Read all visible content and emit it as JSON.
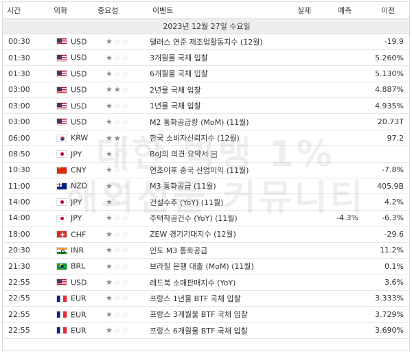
{
  "headers": {
    "time": "시간",
    "currency": "외화",
    "importance": "중요성",
    "event": "이벤트",
    "actual": "실제",
    "forecast": "예측",
    "previous": "이전"
  },
  "date_label": "2023년 12월 27일 수요일",
  "watermark": [
    "대한 빅뱅 1%",
    "해외선물 커뮤니티"
  ],
  "rows": [
    {
      "time": "00:30",
      "flag": "us",
      "currency": "USD",
      "stars": 1,
      "event": "댈러스 연준 제조업활동지수 (12월)",
      "actual": "",
      "forecast": "",
      "previous": "-19.9"
    },
    {
      "time": "01:30",
      "flag": "us",
      "currency": "USD",
      "stars": 1,
      "event": "3개월물 국채 입찰",
      "actual": "",
      "forecast": "",
      "previous": "5.260%"
    },
    {
      "time": "01:30",
      "flag": "us",
      "currency": "USD",
      "stars": 1,
      "event": "6개월물 국채 입찰",
      "actual": "",
      "forecast": "",
      "previous": "5.130%"
    },
    {
      "time": "03:00",
      "flag": "us",
      "currency": "USD",
      "stars": 2,
      "event": "2년물 국채 입찰",
      "actual": "",
      "forecast": "",
      "previous": "4.887%"
    },
    {
      "time": "03:00",
      "flag": "us",
      "currency": "USD",
      "stars": 1,
      "event": "1년물 국채 입찰",
      "actual": "",
      "forecast": "",
      "previous": "4.935%"
    },
    {
      "time": "03:00",
      "flag": "us",
      "currency": "USD",
      "stars": 1,
      "event": "M2 통화공급량 (MoM) (11월)",
      "actual": "",
      "forecast": "",
      "previous": "20.73T"
    },
    {
      "time": "06:00",
      "flag": "kr",
      "currency": "KRW",
      "stars": 2,
      "event": "한국 소비자신뢰지수 (12월)",
      "actual": "",
      "forecast": "",
      "previous": "97.2"
    },
    {
      "time": "08:50",
      "flag": "jp",
      "currency": "JPY",
      "stars": 1,
      "event": "BoJ의 의견 요약서",
      "doc": true,
      "actual": "",
      "forecast": "",
      "previous": ""
    },
    {
      "time": "10:30",
      "flag": "cn",
      "currency": "CNY",
      "stars": 1,
      "event": "연초이후 중국 산업이익 (11월)",
      "actual": "",
      "forecast": "",
      "previous": "-7.8%"
    },
    {
      "time": "11:00",
      "flag": "nz",
      "currency": "NZD",
      "stars": 1,
      "event": "M3 통화공급 (11월)",
      "actual": "",
      "forecast": "",
      "previous": "405.9B"
    },
    {
      "time": "14:00",
      "flag": "jp",
      "currency": "JPY",
      "stars": 1,
      "event": "건설수주 (YoY) (11월)",
      "actual": "",
      "forecast": "",
      "previous": "4.2%"
    },
    {
      "time": "14:00",
      "flag": "jp",
      "currency": "JPY",
      "stars": 1,
      "event": "주택착공건수 (YoY) (11월)",
      "actual": "",
      "forecast": "-4.3%",
      "previous": "-6.3%"
    },
    {
      "time": "18:00",
      "flag": "ch",
      "currency": "CHF",
      "stars": 1,
      "event": "ZEW 경기기대지수 (12월)",
      "actual": "",
      "forecast": "",
      "previous": "-29.6"
    },
    {
      "time": "20:30",
      "flag": "in",
      "currency": "INR",
      "stars": 1,
      "event": "인도 M3 통화공급",
      "actual": "",
      "forecast": "",
      "previous": "11.2%"
    },
    {
      "time": "21:30",
      "flag": "br",
      "currency": "BRL",
      "stars": 1,
      "event": "브라질 은행 대출 (MoM) (11월)",
      "actual": "",
      "forecast": "",
      "previous": "0.1%"
    },
    {
      "time": "22:55",
      "flag": "us",
      "currency": "USD",
      "stars": 1,
      "event": "레드북 소매판매지수 (YoY)",
      "actual": "",
      "forecast": "",
      "previous": "3.6%"
    },
    {
      "time": "22:55",
      "flag": "eu",
      "currency": "EUR",
      "stars": 1,
      "event": "프랑스 1년물 BTF 국채 입찰",
      "actual": "",
      "forecast": "",
      "previous": "3.333%"
    },
    {
      "time": "22:55",
      "flag": "eu",
      "currency": "EUR",
      "stars": 1,
      "event": "프랑스 3개월물 BTF 국채 입찰",
      "actual": "",
      "forecast": "",
      "previous": "3.729%"
    },
    {
      "time": "22:55",
      "flag": "eu",
      "currency": "EUR",
      "stars": 1,
      "event": "프랑스 6개월물 BTF 국채 입찰",
      "actual": "",
      "forecast": "",
      "previous": "3.690%"
    }
  ]
}
